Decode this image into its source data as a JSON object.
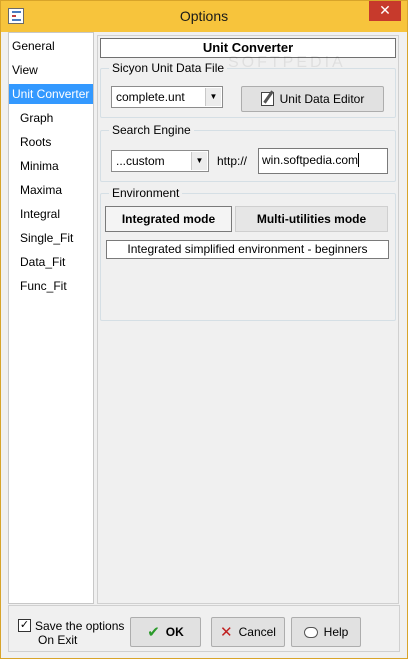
{
  "window": {
    "title": "Options",
    "close_glyph": "✕"
  },
  "nav": {
    "items": [
      {
        "label": "General",
        "selected": false
      },
      {
        "label": "View",
        "selected": false
      },
      {
        "label": "Unit Converter",
        "selected": true
      },
      {
        "label": "Graph",
        "selected": false
      },
      {
        "label": "Roots",
        "selected": false
      },
      {
        "label": "Minima",
        "selected": false
      },
      {
        "label": "Maxima",
        "selected": false
      },
      {
        "label": "Integral",
        "selected": false
      },
      {
        "label": "Single_Fit",
        "selected": false
      },
      {
        "label": "Data_Fit",
        "selected": false
      },
      {
        "label": "Func_Fit",
        "selected": false
      }
    ]
  },
  "panel": {
    "title": "Unit Converter",
    "unit_data_file": {
      "label": "Sicyon Unit Data File",
      "selected": "complete.unt",
      "editor_button": "Unit Data Editor"
    },
    "search_engine": {
      "label": "Search Engine",
      "selected": "...custom",
      "prefix": "http://",
      "url": "win.softpedia.com"
    },
    "environment": {
      "label": "Environment",
      "tabs": [
        {
          "label": "Integrated mode",
          "active": true
        },
        {
          "label": "Multi-utilities mode",
          "active": false
        }
      ],
      "description": "Integrated simplified environment - beginners"
    }
  },
  "footer": {
    "save_checkbox": {
      "checked": true,
      "line1": "Save the options",
      "line2": "On Exit"
    },
    "ok": "OK",
    "cancel": "Cancel",
    "help": "Help"
  },
  "colors": {
    "titlebar": "#f7c43c",
    "selection": "#3399ff",
    "close": "#c73a2c"
  }
}
